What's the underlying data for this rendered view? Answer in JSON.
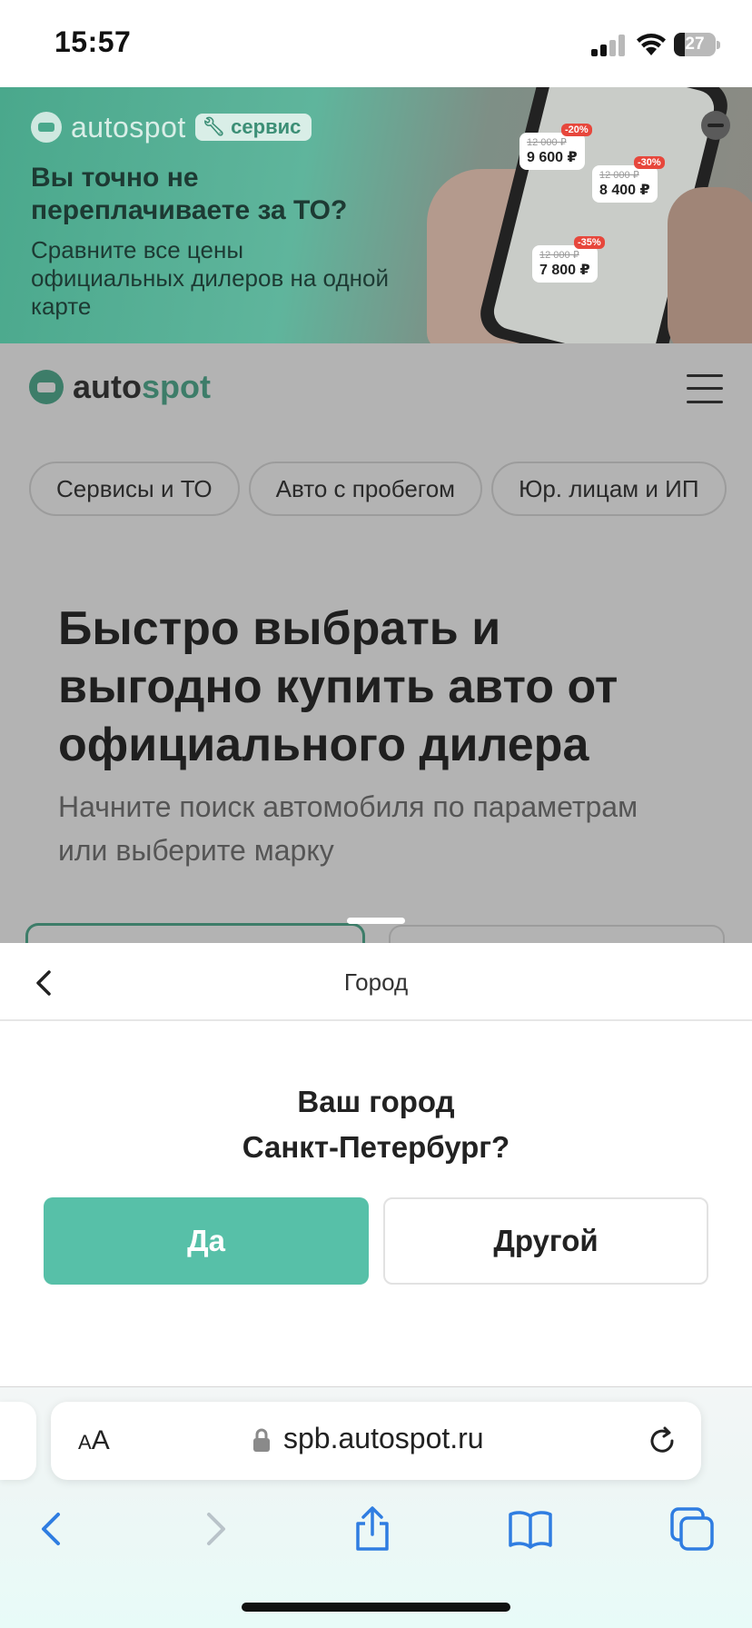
{
  "status_bar": {
    "time": "15:57",
    "battery": "27",
    "battery_level": 0.27
  },
  "banner": {
    "brand": "autospot",
    "badge": "сервис",
    "headline": "Вы точно не переплачиваете за ТО?",
    "subline": "Сравните все цены официальных дилеров на одной карте",
    "price_tags": [
      {
        "old": "12 000 ₽",
        "price": "9 600 ₽",
        "discount": "-20%"
      },
      {
        "old": "12 000 ₽",
        "price": "8 400 ₽",
        "discount": "-30%"
      },
      {
        "old": "12 000 ₽",
        "price": "7 800 ₽",
        "discount": "-35%"
      }
    ]
  },
  "header": {
    "brand_auto": "auto",
    "brand_spot": "spot"
  },
  "chips": [
    "Сервисы и ТО",
    "Авто с пробегом",
    "Юр. лицам и ИП"
  ],
  "hero": {
    "title": "Быстро выбрать и выгодно купить авто от официального дилера",
    "subtitle": "Начните поиск автомобиля по параметрам или выберите марку"
  },
  "sheet": {
    "title": "Город",
    "question_line1": "Ваш город",
    "question_line2": "Санкт-Петербург?",
    "yes_label": "Да",
    "other_label": "Другой"
  },
  "browser": {
    "aa_small": "A",
    "aa_large": "A",
    "url": "spb.autospot.ru"
  },
  "colors": {
    "accent": "#57c0a8",
    "brand_dark": "#3d7d69",
    "overlay": "#b3b3b3"
  }
}
